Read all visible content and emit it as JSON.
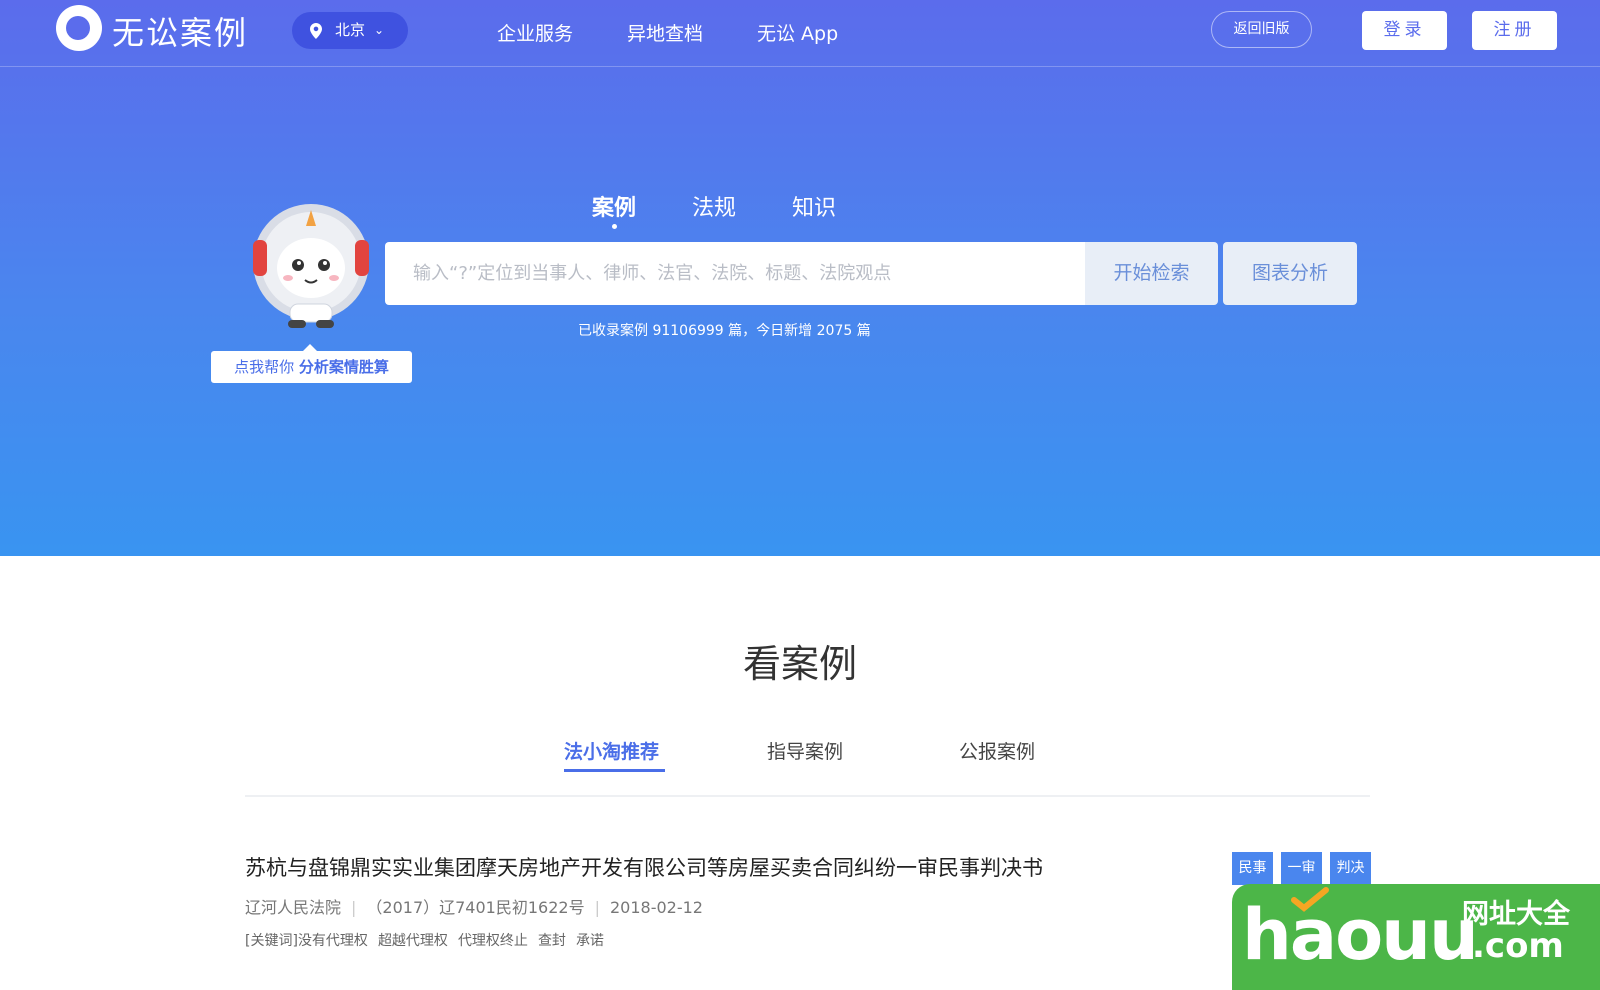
{
  "header": {
    "logo_text": "无讼案例",
    "city": "北京",
    "nav": [
      "企业服务",
      "异地查档",
      "无讼 App"
    ],
    "old_version": "返回旧版",
    "login": "登录",
    "register": "注册"
  },
  "search": {
    "tabs": [
      "案例",
      "法规",
      "知识"
    ],
    "active_tab": "案例",
    "placeholder": "输入“?”定位到当事人、律师、法官、法院、标题、法院观点",
    "search_button": "开始检索",
    "chart_button": "图表分析",
    "stats_prefix": "已收录案例",
    "stats_count": "91106999",
    "stats_mid": "篇，今日新增",
    "stats_today": "2075",
    "stats_suffix": "篇"
  },
  "mascot": {
    "bubble_prefix": "点我帮你",
    "bubble_strong": "分析案情胜算"
  },
  "cases": {
    "section_title": "看案例",
    "tabs": [
      "法小淘推荐",
      "指导案例",
      "公报案例"
    ],
    "active_tab": "法小淘推荐",
    "items": [
      {
        "title": "苏杭与盘锦鼎实实业集团摩天房地产开发有限公司等房屋买卖合同纠纷一审民事判决书",
        "court": "辽河人民法院",
        "case_no": "（2017）辽7401民初1622号",
        "date": "2018-02-12",
        "keywords_label": "[关键词]",
        "keywords": [
          "没有代理权",
          "超越代理权",
          "代理权终止",
          "查封",
          "承诺"
        ],
        "tags": [
          "民事",
          "一审",
          "判决"
        ]
      }
    ]
  },
  "watermark": {
    "brand": "haouu",
    "cn": "网址大全",
    "domain": ".com"
  },
  "colors": {
    "primary": "#5b6cec",
    "accent": "#4a6ee8",
    "tag": "#4a86ee",
    "watermark_green": "#4cb648"
  }
}
